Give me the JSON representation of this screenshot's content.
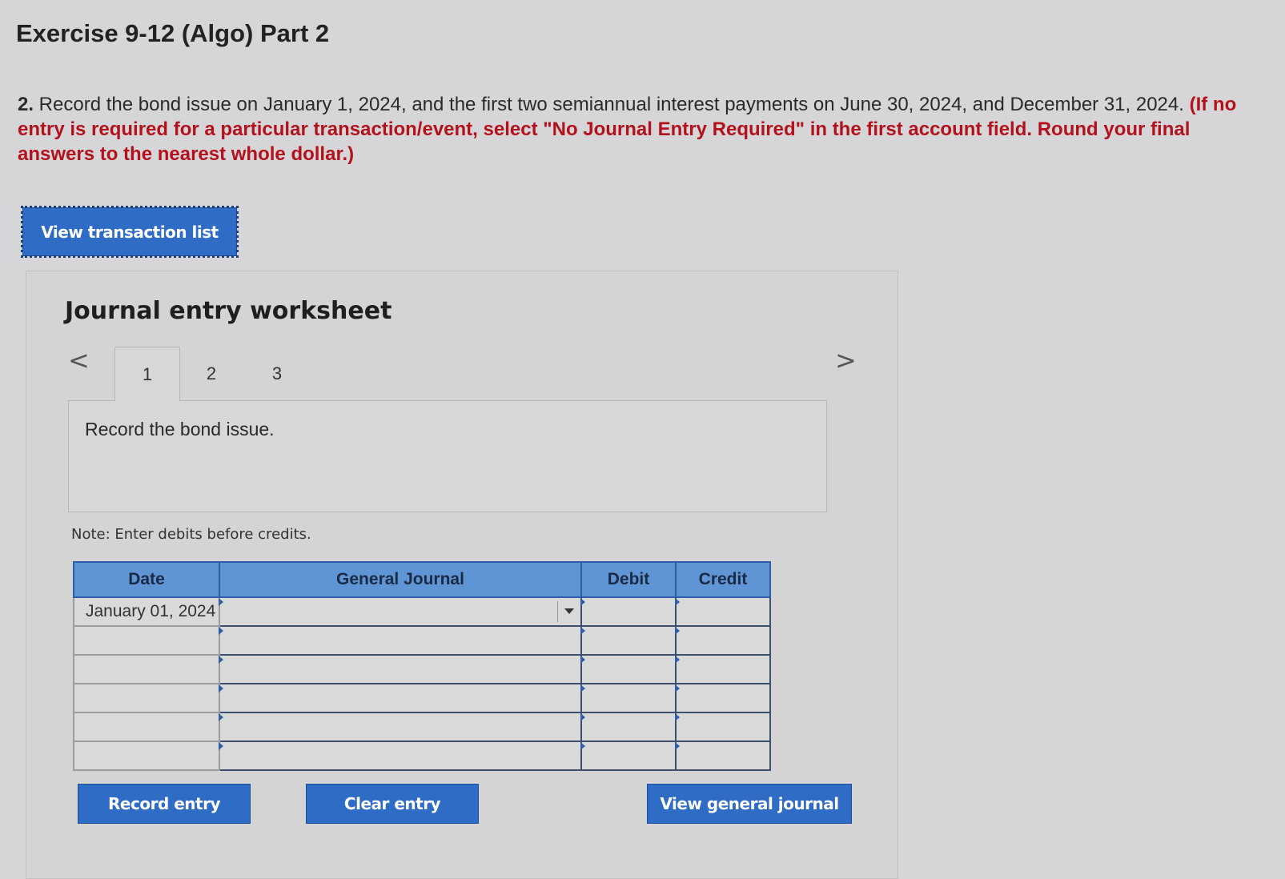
{
  "header": {
    "title": "Exercise 9-12 (Algo) Part 2"
  },
  "instructions": {
    "number": "2.",
    "text": " Record the bond issue on January 1, 2024, and the first two semiannual interest payments on June 30, 2024, and December 31, 2024. ",
    "emphasis": "(If no entry is required for a particular transaction/event, select \"No Journal Entry Required\" in the first account field. Round your final answers to the nearest whole dollar.)"
  },
  "buttons": {
    "view_transaction_list": "View transaction list",
    "record_entry": "Record entry",
    "clear_entry": "Clear entry",
    "view_general_journal": "View general journal"
  },
  "worksheet": {
    "title": "Journal entry worksheet",
    "nav_prev": "<",
    "nav_next": ">",
    "tabs": [
      "1",
      "2",
      "3"
    ],
    "active_tab": "1",
    "description": "Record the bond issue.",
    "note": "Note: Enter debits before credits."
  },
  "journal_table": {
    "headers": {
      "date": "Date",
      "general_journal": "General Journal",
      "debit": "Debit",
      "credit": "Credit"
    },
    "rows": [
      {
        "date": "January 01, 2024",
        "account": "",
        "debit": "",
        "credit": ""
      },
      {
        "date": "",
        "account": "",
        "debit": "",
        "credit": ""
      },
      {
        "date": "",
        "account": "",
        "debit": "",
        "credit": ""
      },
      {
        "date": "",
        "account": "",
        "debit": "",
        "credit": ""
      },
      {
        "date": "",
        "account": "",
        "debit": "",
        "credit": ""
      },
      {
        "date": "",
        "account": "",
        "debit": "",
        "credit": ""
      }
    ]
  },
  "colors": {
    "button_blue": "#2f6cc6",
    "table_header": "#5f95d4",
    "instruction_red": "#b3121c",
    "background": "#d6d6d8"
  }
}
